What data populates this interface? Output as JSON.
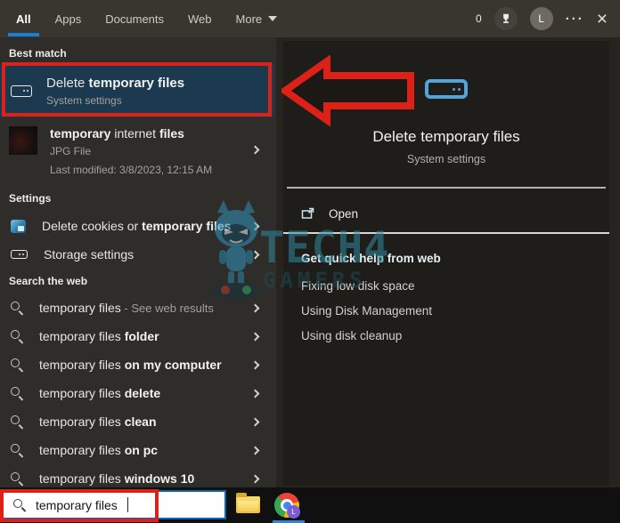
{
  "colors": {
    "accent_blue": "#1b7fd4",
    "annotation_red": "#de2117",
    "highlight_row": "#1c3a4f",
    "panel_icon_blue": "#51a5dc"
  },
  "tabs": {
    "all": "All",
    "apps": "Apps",
    "documents": "Documents",
    "web": "Web",
    "more": "More"
  },
  "topbar": {
    "rewards_count": "0",
    "avatar_initial": "L",
    "ellipsis_glyph": "···",
    "close_glyph": "×"
  },
  "left": {
    "best_match_header": "Best match",
    "best_match": {
      "title_pre": "Delete ",
      "title_bold": "temporary files",
      "subtitle": "System settings"
    },
    "file_result": {
      "title_bold1": "temporary",
      "title_mid": " internet ",
      "title_bold2": "files",
      "file_type": "JPG File",
      "last_modified": "Last modified: 3/8/2023, 12:15 AM"
    },
    "settings_header": "Settings",
    "settings_items": [
      {
        "pre": "Delete cookies or ",
        "bold": "temporary files"
      },
      {
        "pre": "Storage settings",
        "bold": ""
      }
    ],
    "web_header": "Search the web",
    "web_items": [
      {
        "pre": "temporary files",
        "bold": "",
        "suffix": " - See web results"
      },
      {
        "pre": "temporary files ",
        "bold": "folder",
        "suffix": ""
      },
      {
        "pre": "temporary files ",
        "bold": "on my computer",
        "suffix": ""
      },
      {
        "pre": "temporary files ",
        "bold": "delete",
        "suffix": ""
      },
      {
        "pre": "temporary files ",
        "bold": "clean",
        "suffix": ""
      },
      {
        "pre": "temporary files ",
        "bold": "on pc",
        "suffix": ""
      },
      {
        "pre": "temporary files ",
        "bold": "windows 10",
        "suffix": ""
      }
    ]
  },
  "right": {
    "title": "Delete temporary files",
    "subtitle": "System settings",
    "open_label": "Open",
    "links": [
      "Get quick help from web",
      "Fixing low disk space",
      "Using Disk Management",
      "Using disk cleanup"
    ]
  },
  "search": {
    "value": "temporary files"
  },
  "watermark": {
    "line1": "TECH4",
    "line2": "GAMERS"
  }
}
